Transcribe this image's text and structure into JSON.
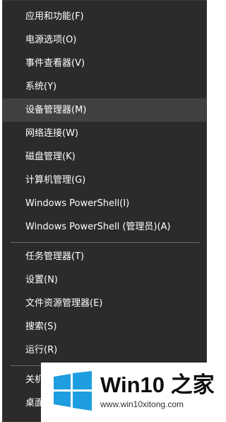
{
  "menu": {
    "items": [
      {
        "label": "应用和功能(F)"
      },
      {
        "label": "电源选项(O)"
      },
      {
        "label": "事件查看器(V)"
      },
      {
        "label": "系统(Y)"
      },
      {
        "label": "设备管理器(M)"
      },
      {
        "label": "网络连接(W)"
      },
      {
        "label": "磁盘管理(K)"
      },
      {
        "label": "计算机管理(G)"
      },
      {
        "label": "Windows PowerShell(I)"
      },
      {
        "label": "Windows PowerShell (管理员)(A)"
      },
      {
        "label": "任务管理器(T)"
      },
      {
        "label": "设置(N)"
      },
      {
        "label": "文件资源管理器(E)"
      },
      {
        "label": "搜索(S)"
      },
      {
        "label": "运行(R)"
      },
      {
        "label": "关机"
      },
      {
        "label": "桌面"
      }
    ]
  },
  "watermark": {
    "brand": "Win10 之家",
    "url": "www.win10xitong.com"
  },
  "colors": {
    "menu_bg": "#2b2b2b",
    "hover_bg": "#414141",
    "separator": "#6b6b6b",
    "text": "#ffffff",
    "logo_blue": "#1e9de0"
  }
}
